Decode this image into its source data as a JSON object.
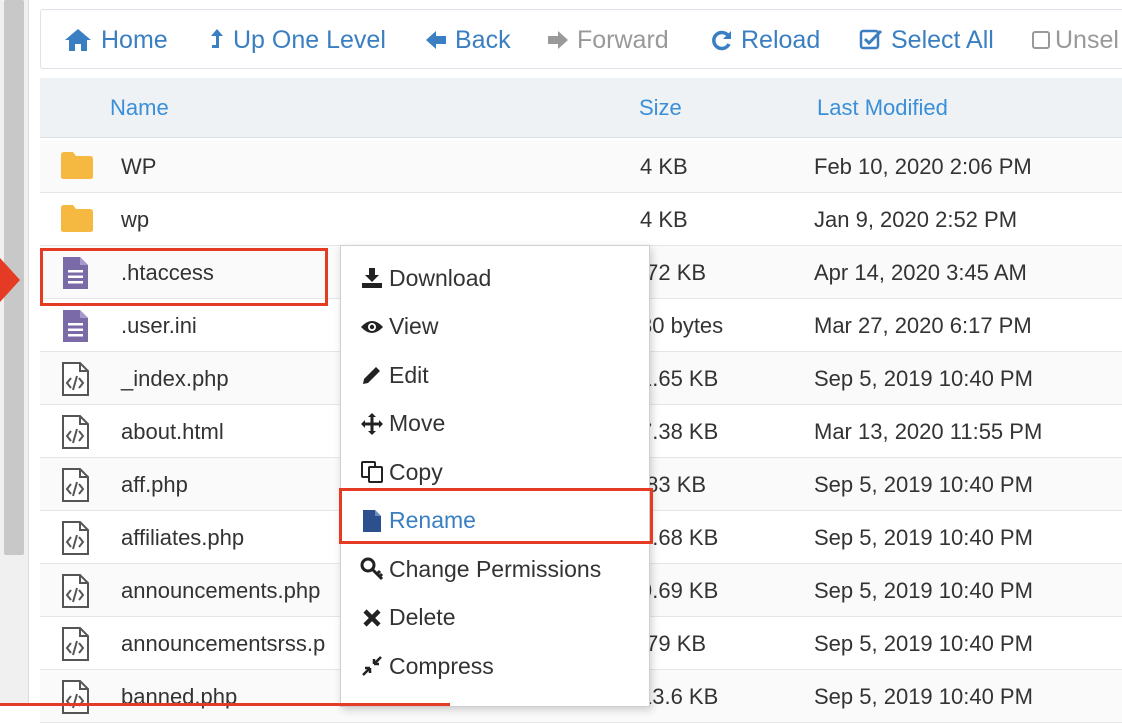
{
  "toolbar": {
    "home": "Home",
    "up_one_level": "Up One Level",
    "back": "Back",
    "forward": "Forward",
    "reload": "Reload",
    "select_all": "Select All",
    "unselect": "Unsel"
  },
  "table": {
    "columns": {
      "name": "Name",
      "size": "Size",
      "last_modified": "Last Modified"
    },
    "rows": [
      {
        "name": "WP",
        "size": "4 KB",
        "modified": "Feb 10, 2020 2:06 PM",
        "icon": "folder-icon"
      },
      {
        "name": "wp",
        "size": "4 KB",
        "modified": "Jan 9, 2020 2:52 PM",
        "icon": "folder-icon"
      },
      {
        "name": ".htaccess",
        "size": ".72 KB",
        "modified": "Apr 14, 2020 3:45 AM",
        "icon": "text-file-icon"
      },
      {
        "name": ".user.ini",
        "size": "30 bytes",
        "modified": "Mar 27, 2020 6:17 PM",
        "icon": "text-file-icon"
      },
      {
        "name": "_index.php",
        "size": "1.65 KB",
        "modified": "Sep 5, 2019 10:40 PM",
        "icon": "code-file-icon"
      },
      {
        "name": "about.html",
        "size": "7.38 KB",
        "modified": "Mar 13, 2020 11:55 PM",
        "icon": "code-file-icon"
      },
      {
        "name": "aff.php",
        "size": ".83 KB",
        "modified": "Sep 5, 2019 10:40 PM",
        "icon": "code-file-icon"
      },
      {
        "name": "affiliates.php",
        "size": "0.68 KB",
        "modified": "Sep 5, 2019 10:40 PM",
        "icon": "code-file-icon"
      },
      {
        "name": "announcements.php",
        "size": "9.69 KB",
        "modified": "Sep 5, 2019 10:40 PM",
        "icon": "code-file-icon"
      },
      {
        "name": "announcementsrss.p",
        "size": ".79 KB",
        "modified": "Sep 5, 2019 10:40 PM",
        "icon": "code-file-icon"
      },
      {
        "name": "banned.php",
        "size": "13.6 KB",
        "modified": "Sep 5, 2019 10:40 PM",
        "icon": "code-file-icon"
      }
    ]
  },
  "context_menu": {
    "items": [
      {
        "label": "Download",
        "icon": "download-icon"
      },
      {
        "label": "View",
        "icon": "eye-icon"
      },
      {
        "label": "Edit",
        "icon": "pencil-icon"
      },
      {
        "label": "Move",
        "icon": "move-icon"
      },
      {
        "label": "Copy",
        "icon": "copy-icon"
      },
      {
        "label": "Rename",
        "icon": "rename-file-icon"
      },
      {
        "label": "Change Permissions",
        "icon": "key-icon"
      },
      {
        "label": "Delete",
        "icon": "delete-x-icon"
      },
      {
        "label": "Compress",
        "icon": "compress-icon"
      }
    ]
  },
  "colors": {
    "link_blue": "#3a7fc1",
    "highlight_red": "#e53a24",
    "folder_yellow": "#f5b942",
    "text_file_purple": "#7b6aa8"
  }
}
